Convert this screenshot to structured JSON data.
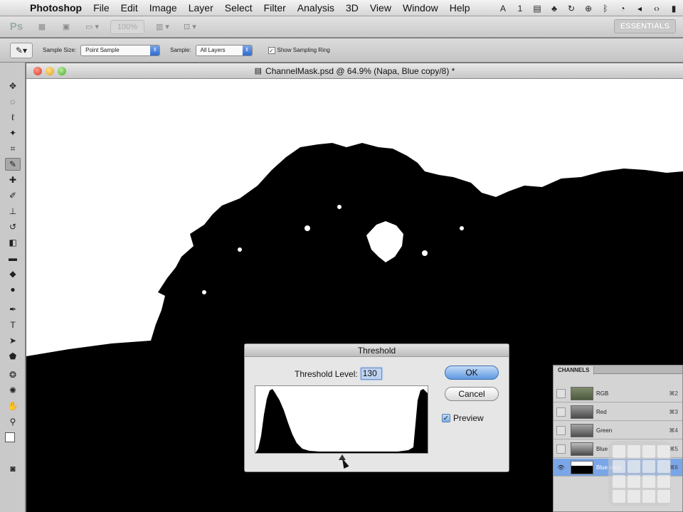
{
  "menubar": {
    "apple_icon": "apple-icon",
    "app_name": "Photoshop",
    "items": [
      "File",
      "Edit",
      "Image",
      "Layer",
      "Select",
      "Filter",
      "Analysis",
      "3D",
      "View",
      "Window",
      "Help"
    ],
    "status": {
      "adobe": "1"
    }
  },
  "appbar": {
    "ps_label": "Ps",
    "zoom_value": "100%",
    "essentials_label": "ESSENTIALS"
  },
  "options": {
    "sample_size_label": "Sample Size:",
    "sample_size_value": "Point Sample",
    "sample_label": "Sample:",
    "sample_value": "All Layers",
    "show_ring_label": "Show Sampling Ring",
    "show_ring_checked": true
  },
  "document": {
    "title": "ChannelMask.psd @ 64.9% (Napa, Blue copy/8) *"
  },
  "threshold": {
    "title": "Threshold",
    "level_label": "Threshold Level:",
    "level_value": "130",
    "ok_label": "OK",
    "cancel_label": "Cancel",
    "preview_label": "Preview",
    "preview_checked": true
  },
  "channels": {
    "tab_label": "CHANNELS",
    "rows": [
      {
        "name": "RGB",
        "shortcut": "⌘2"
      },
      {
        "name": "Red",
        "shortcut": "⌘3"
      },
      {
        "name": "Green",
        "shortcut": "⌘4"
      },
      {
        "name": "Blue",
        "shortcut": "⌘5"
      },
      {
        "name": "Blue copy",
        "shortcut": "⌘6"
      }
    ]
  },
  "colors": {
    "accent": "#5e98e0",
    "selection": "#7aa5e6"
  }
}
